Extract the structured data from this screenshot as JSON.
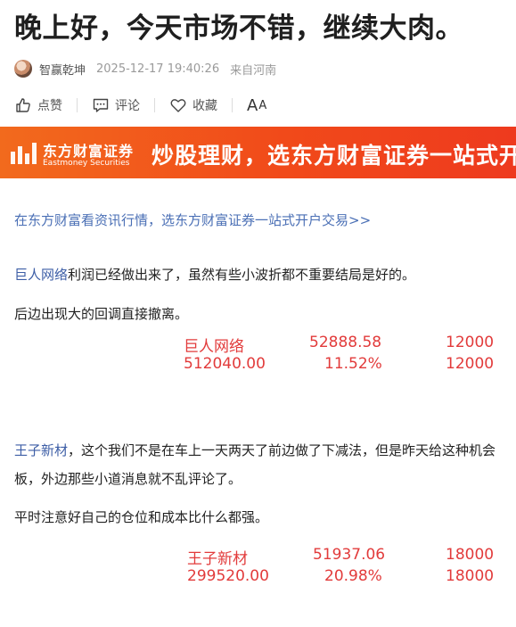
{
  "article": {
    "title": "晚上好，今天市场不错，继续大肉。",
    "author": "智赢乾坤",
    "datetime": "2025-12-17 19:40:26",
    "source": "来自河南"
  },
  "actions": {
    "like": "点赞",
    "comment": "评论",
    "favorite": "收藏",
    "font_big": "A",
    "font_small": "A"
  },
  "banner": {
    "logo_cn": "东方财富证券",
    "logo_en": "Eastmoney Securities",
    "slogan": "炒股理财，选东方财富证券一站式开"
  },
  "body": {
    "promo_link": "在东方财富看资讯行情，选东方财富证券一站式开户交易>>",
    "para1_stock": "巨人网络",
    "para1_text": "利润已经做出来了，虽然有些小波折都不重要结局是好的。",
    "para2": "后边出现大的回调直接撤离。",
    "table1": {
      "row1": [
        "巨人网络",
        "52888.58",
        "12000"
      ],
      "row2": [
        "512040.00",
        "11.52%",
        "12000"
      ]
    },
    "para3_stock": "王子新材",
    "para3_text": "，这个我们不是在车上一天两天了前边做了下减法，但是昨天给这种机会",
    "para3_cont": "板，外边那些小道消息就不乱评论了。",
    "para4": "平时注意好自己的仓位和成本比什么都强。",
    "table2": {
      "row1": [
        "王子新材",
        "51937.06",
        "18000"
      ],
      "row2": [
        "299520.00",
        "20.98%",
        "18000"
      ]
    }
  },
  "colors": {
    "accent_red": "#e23b3b",
    "link_blue": "#4a6fb5",
    "banner_orange": "#f14a1a"
  }
}
